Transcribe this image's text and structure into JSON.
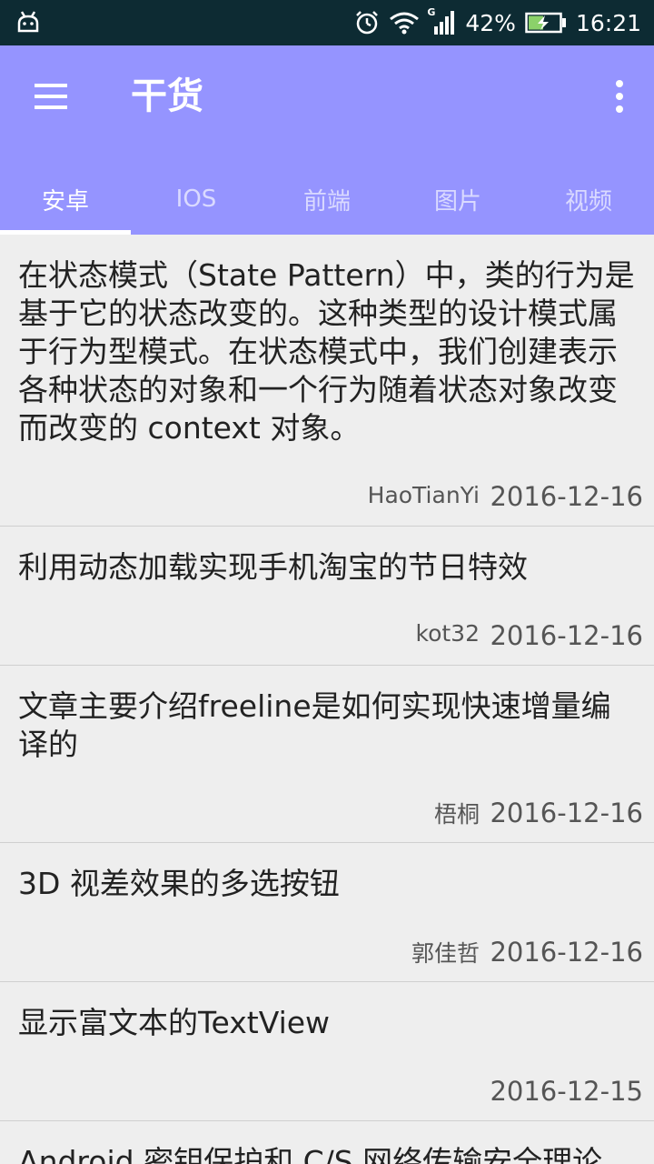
{
  "status_bar": {
    "battery": "42%",
    "time": "16:21",
    "network": "G"
  },
  "app_bar": {
    "title": "干货"
  },
  "tabs": [
    {
      "label": "安卓",
      "active": true
    },
    {
      "label": "IOS",
      "active": false
    },
    {
      "label": "前端",
      "active": false
    },
    {
      "label": "图片",
      "active": false
    },
    {
      "label": "视频",
      "active": false
    }
  ],
  "articles": [
    {
      "title": "在状态模式（State Pattern）中，类的行为是基于它的状态改变的。这种类型的设计模式属于行为型模式。在状态模式中，我们创建表示各种状态的对象和一个行为随着状态对象改变而改变的 context 对象。",
      "author": "HaoTianYi",
      "date": "2016-12-16"
    },
    {
      "title": "利用动态加载实现手机淘宝的节日特效",
      "author": "kot32",
      "date": "2016-12-16"
    },
    {
      "title": "文章主要介绍freeline是如何实现快速增量编译的",
      "author": "梧桐",
      "date": "2016-12-16"
    },
    {
      "title": "3D 视差效果的多选按钮",
      "author": "郭佳哲",
      "date": "2016-12-16"
    },
    {
      "title": "显示富文本的TextView",
      "author": "",
      "date": "2016-12-15"
    },
    {
      "title": "Android 密钥保护和 C/S 网络传输安全理论",
      "author": "",
      "date": ""
    }
  ],
  "colors": {
    "status_bar": "#0d2b33",
    "app_bar": "#9594ff",
    "background": "#eeeeee"
  },
  "icons": {
    "android": "android-icon",
    "alarm": "alarm-icon",
    "wifi": "wifi-icon",
    "signal": "signal-icon",
    "battery": "battery-charging-icon",
    "menu": "menu-icon",
    "more": "more-vert-icon"
  }
}
